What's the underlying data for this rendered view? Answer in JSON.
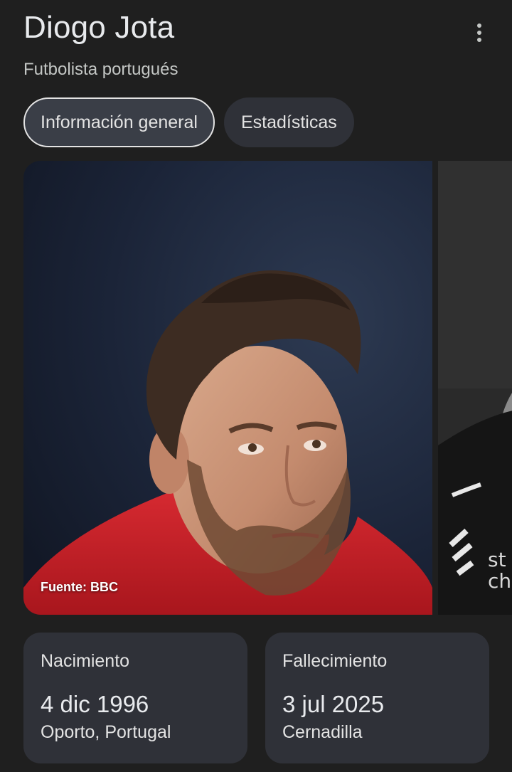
{
  "header": {
    "title": "Diogo Jota",
    "subtitle": "Futbolista portugués",
    "more_icon": "more-vert-icon"
  },
  "tabs": [
    {
      "label": "Información general",
      "active": true
    },
    {
      "label": "Estadísticas",
      "active": false
    }
  ],
  "images": {
    "main": {
      "source": "Fuente: BBC"
    },
    "second": {}
  },
  "facts": [
    {
      "label": "Nacimiento",
      "date": "4 dic 1996",
      "place": "Oporto, Portugal"
    },
    {
      "label": "Fallecimiento",
      "date": "3 jul 2025",
      "place": "Cernadilla"
    }
  ],
  "colors": {
    "background": "#1f1f1f",
    "chip": "#2f3138",
    "chip_active_border": "#e3e3e3",
    "jersey_red": "#c8202a"
  }
}
